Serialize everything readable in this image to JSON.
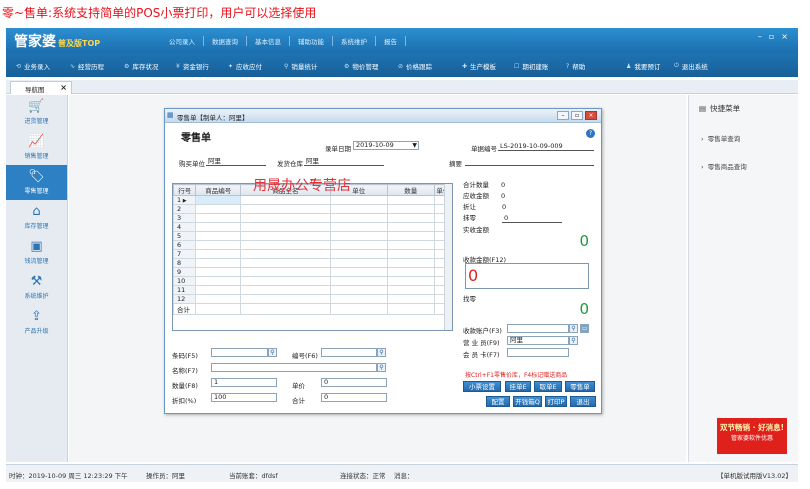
{
  "caption": "零~售单:系统支持简单的POS小票打印，用户可以选择使用",
  "app": {
    "logo": "管家婆",
    "edition": "普及版TOP",
    "top_menu": [
      "公司录入",
      "数据查询",
      "基本信息",
      "辅助功能",
      "系统维护",
      "报告"
    ],
    "window_controls": [
      "–",
      "▫",
      "×"
    ]
  },
  "toolbar": [
    {
      "icon": "refresh-icon",
      "glyph": "⟲",
      "label": "业务录入"
    },
    {
      "icon": "chart-icon",
      "glyph": "∿",
      "label": "经营历程"
    },
    {
      "icon": "gear-icon",
      "glyph": "⚙",
      "label": "库存状况"
    },
    {
      "icon": "money-icon",
      "glyph": "¥",
      "label": "资金银行"
    },
    {
      "icon": "due-icon",
      "glyph": "✦",
      "label": "应收应付"
    },
    {
      "icon": "search-icon",
      "glyph": "⚲",
      "label": "销量统计"
    },
    {
      "icon": "settings-icon",
      "glyph": "⚙",
      "label": "物价管理"
    },
    {
      "icon": "tag-icon",
      "glyph": "⊘",
      "label": "价格跟踪"
    },
    {
      "icon": "produce-icon",
      "glyph": "✚",
      "label": "生产模板"
    },
    {
      "icon": "doc-icon",
      "glyph": "☐",
      "label": "期初建账"
    },
    {
      "icon": "help-icon",
      "glyph": "?",
      "label": "帮助"
    },
    {
      "icon": "user-icon",
      "glyph": "♟",
      "label": "我要预订"
    },
    {
      "icon": "power-icon",
      "glyph": "⏻",
      "label": "退出系统"
    }
  ],
  "nav_tab": {
    "label": "导航图",
    "close": "×"
  },
  "sidebar": [
    {
      "icon": "cart-icon",
      "glyph": "🛒",
      "label": "进货管理",
      "active": false
    },
    {
      "icon": "trend-icon",
      "glyph": "📈",
      "label": "销售管理",
      "active": false
    },
    {
      "icon": "tag-icon",
      "glyph": "🏷",
      "label": "零售管理",
      "active": true
    },
    {
      "icon": "home-icon",
      "glyph": "⌂",
      "label": "库存管理",
      "active": false
    },
    {
      "icon": "cash-icon",
      "glyph": "▣",
      "label": "钱流管理",
      "active": false
    },
    {
      "icon": "tools-icon",
      "glyph": "⚒",
      "label": "系统维护",
      "active": false
    },
    {
      "icon": "upgrade-icon",
      "glyph": "⇪",
      "label": "产品升级",
      "active": false
    }
  ],
  "right_panel": {
    "title": "快捷菜单",
    "links": [
      "零售单查询",
      "零售商品查询"
    ],
    "promo_line1": "双节畅销 · 好消息!",
    "promo_line2": "管家婆软件优惠"
  },
  "dialog": {
    "title": "零售单【制单人：阿里】",
    "heading": "零售单",
    "help": "?",
    "date_label": "录单日期",
    "date_value": "2019-10-09",
    "billno_label": "单据编号",
    "billno_value": "LS-2019-10-09-009",
    "buyer_label": "购买单位",
    "buyer_value": "阿里",
    "warehouse_label": "发货仓库",
    "warehouse_value": "阿里",
    "remark_label": "摘要",
    "grid": {
      "headers": [
        "行号",
        "商品编号",
        "商品全名",
        "单位",
        "数量",
        "单价"
      ],
      "rows": [
        "1",
        "2",
        "3",
        "4",
        "5",
        "6",
        "7",
        "8",
        "9",
        "10",
        "11",
        "12"
      ],
      "total_label": "合计"
    },
    "watermark": "用晟办公专营店",
    "summary": {
      "qty_label": "合计数量",
      "qty_value": "0",
      "due_label": "应收金额",
      "due_value": "0",
      "discount_label": "折让",
      "discount_value": "0",
      "round_label": "抹零",
      "round_value": "0",
      "actual_label": "实收金额",
      "actual_value": "0",
      "received_label": "收款金额(F12)",
      "received_value": "0",
      "change_label": "找零",
      "change_value": "0",
      "account_label": "收款账户(F3)",
      "salesman_label": "营 业 员(F9)",
      "salesman_value": "阿里",
      "member_label": "会 员 卡(F7)"
    },
    "hint": "按Ctrl+F1零售价库，F4标记赠送商品",
    "bottom": {
      "barcode_label": "条码(F5)",
      "code_label": "编号(F6)",
      "name_label": "名称(F7)",
      "qty_label": "数量(F8)",
      "qty_value": "1",
      "price_label": "单价",
      "price_value": "0",
      "discount_label": "折扣(%)",
      "discount_value": "100",
      "total_label": "合计",
      "total_value": "0"
    },
    "buttons_row1": [
      "小票设置",
      "挂单E",
      "取单E",
      "零售单"
    ],
    "buttons_row2": [
      "配置",
      "开钱箱Q",
      "打印P",
      "退出"
    ]
  },
  "statusbar": {
    "time": "时钟：2019-10-09 周三 12:23:29 下午",
    "operator": "操作员：阿里",
    "account": "当前账套：dfdsf",
    "connection": "连接状态：正常",
    "message": "消息：",
    "version": "【单机版试用版V13.02】"
  }
}
